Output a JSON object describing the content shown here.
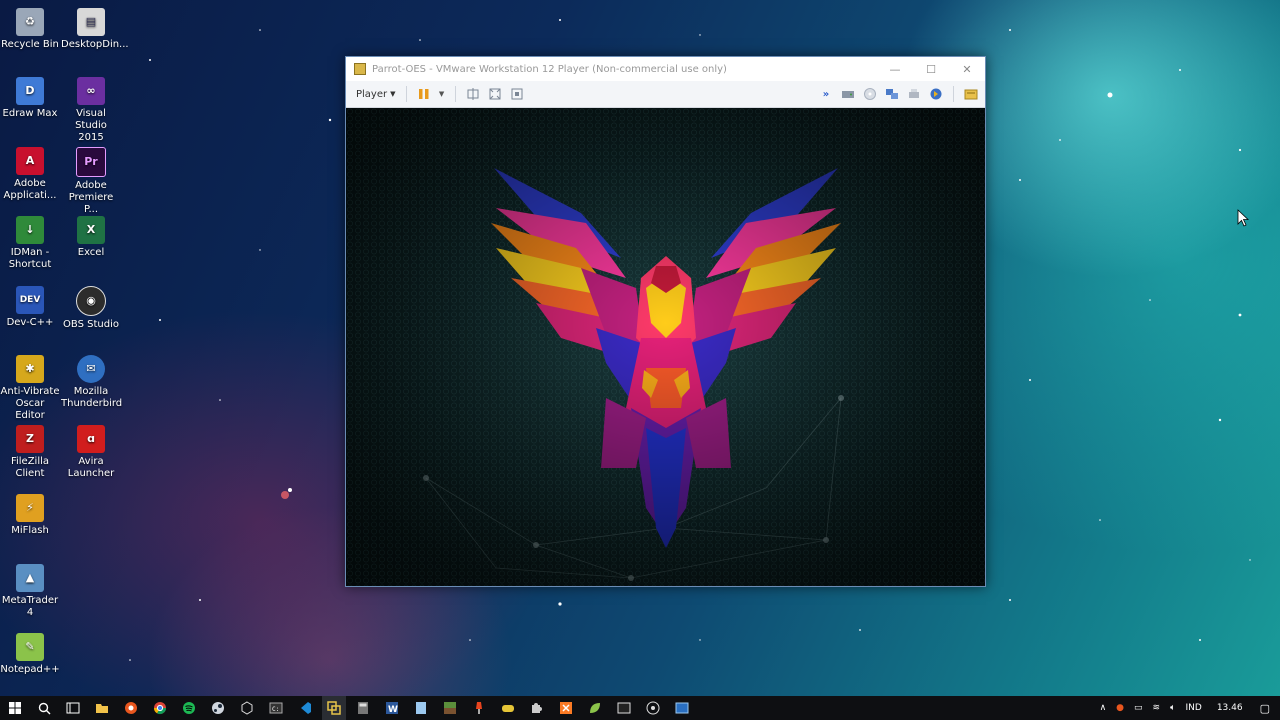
{
  "desktop": {
    "icons": [
      {
        "label": "Recycle Bin",
        "icon": "recycle-bin-icon",
        "color": "#9aa7b8"
      },
      {
        "label": "DesktopDin...",
        "icon": "file-icon",
        "color": "#d8d8d8"
      },
      {
        "label": "Edraw Max",
        "icon": "edraw-icon",
        "color": "#3f7ad6"
      },
      {
        "label": "Visual Studio 2015",
        "icon": "visual-studio-icon",
        "color": "#6b2fa0"
      },
      {
        "label": "Adobe Applicati...",
        "icon": "adobe-icon",
        "color": "#c8102e"
      },
      {
        "label": "Adobe Premiere P...",
        "icon": "premiere-icon",
        "color": "#2a0a3d"
      },
      {
        "label": "IDMan - Shortcut",
        "icon": "idm-icon",
        "color": "#2f8a3a"
      },
      {
        "label": "Excel",
        "icon": "excel-icon",
        "color": "#1f7244"
      },
      {
        "label": "Dev-C++",
        "icon": "devcpp-icon",
        "color": "#2a56b8"
      },
      {
        "label": "OBS Studio",
        "icon": "obs-icon",
        "color": "#2c2c2c"
      },
      {
        "label": "Anti-Vibrate Oscar Editor",
        "icon": "oscar-icon",
        "color": "#d6a81c"
      },
      {
        "label": "Mozilla Thunderbird",
        "icon": "thunderbird-icon",
        "color": "#2f6fc1"
      },
      {
        "label": "FileZilla Client",
        "icon": "filezilla-icon",
        "color": "#bf1e1e"
      },
      {
        "label": "Avira Launcher",
        "icon": "avira-icon",
        "color": "#d11d1d"
      },
      {
        "label": "MiFlash",
        "icon": "miflash-icon",
        "color": "#e0a020"
      },
      {
        "label": "MetaTrader 4",
        "icon": "metatrader-icon",
        "color": "#5a8fc2"
      },
      {
        "label": "Notepad++",
        "icon": "notepadpp-icon",
        "color": "#8bc34a"
      }
    ]
  },
  "vm_window": {
    "title": "Parrot-OES - VMware Workstation 12 Player (Non-commercial use only)",
    "menu_player": "Player",
    "minimize": "—",
    "maximize": "☐",
    "close": "✕"
  },
  "taskbar": {
    "language": "IND",
    "time": "13.46"
  }
}
